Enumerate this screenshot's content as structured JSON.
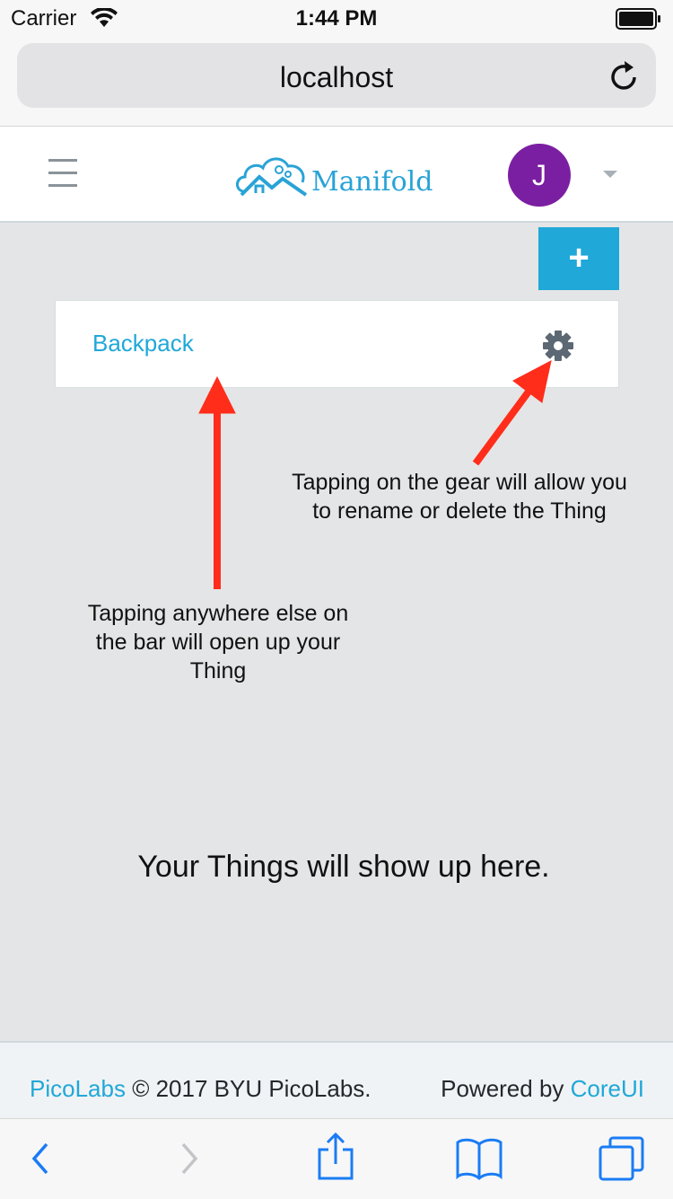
{
  "status_bar": {
    "carrier": "Carrier",
    "time": "1:44 PM",
    "icons": [
      "wifi-icon",
      "battery-icon"
    ]
  },
  "browser": {
    "address": "localhost",
    "reload_icon": "reload-icon"
  },
  "header": {
    "menu_icon": "hamburger-icon",
    "logo_text": "Manifold",
    "avatar_initial": "J",
    "avatar_color": "#7b1fa2",
    "brand_color": "#29a3d6"
  },
  "actions": {
    "add_label": "+",
    "add_color": "#20a8d8"
  },
  "things": [
    {
      "name": "Backpack",
      "settings_icon": "gear-icon"
    }
  ],
  "annotations": {
    "gear": "Tapping on the gear will allow you to rename or delete the Thing",
    "bar": "Tapping anywhere else on the bar will open up your Thing",
    "arrow_color": "#ff2d1a"
  },
  "empty_message": "Your Things will show up here.",
  "footer": {
    "brand_link": "PicoLabs",
    "copyright": " © 2017 BYU PicoLabs.",
    "powered_by": "Powered by ",
    "coreui_link": "CoreUI"
  },
  "toolbar": {
    "icons": [
      "back-icon",
      "forward-icon",
      "share-icon",
      "bookmarks-icon",
      "tabs-icon"
    ],
    "tint": "#1a7cf5"
  }
}
